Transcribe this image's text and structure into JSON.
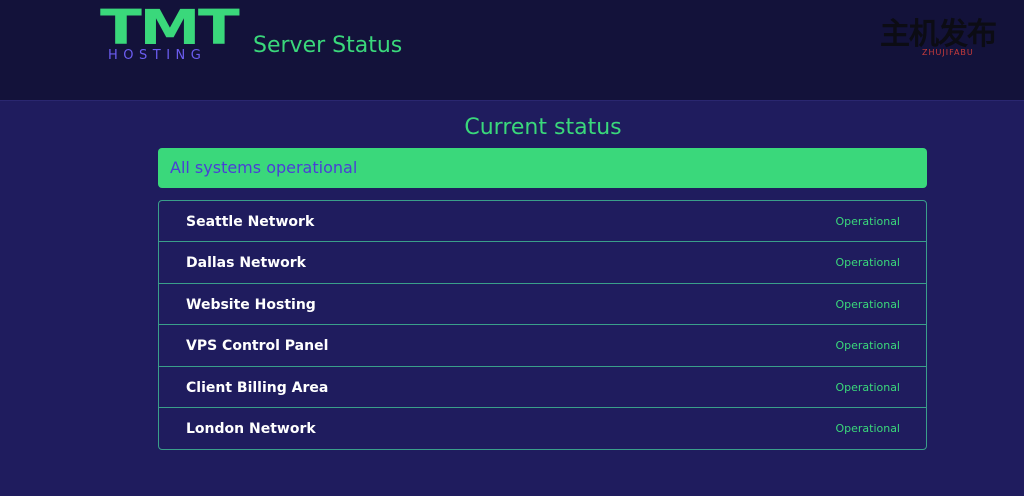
{
  "header": {
    "logo_letters": "TMT",
    "logo_sub": "HOSTING",
    "title": "Server Status",
    "watermark_main": "主机发布",
    "watermark_sub": "ZHUJIFABU"
  },
  "main": {
    "heading": "Current status",
    "banner": "All systems operational",
    "services": [
      {
        "name": "Seattle Network",
        "status": "Operational"
      },
      {
        "name": "Dallas Network",
        "status": "Operational"
      },
      {
        "name": "Website Hosting",
        "status": "Operational"
      },
      {
        "name": "VPS Control Panel",
        "status": "Operational"
      },
      {
        "name": "Client Billing Area",
        "status": "Operational"
      },
      {
        "name": "London Network",
        "status": "Operational"
      }
    ]
  },
  "colors": {
    "background": "#1f1c5e",
    "topbar": "#13123a",
    "accent_green": "#3ad87b",
    "banner_text": "#4a3fd6",
    "logo_sub": "#6b5cf0",
    "row_border": "#3a9e8a"
  }
}
